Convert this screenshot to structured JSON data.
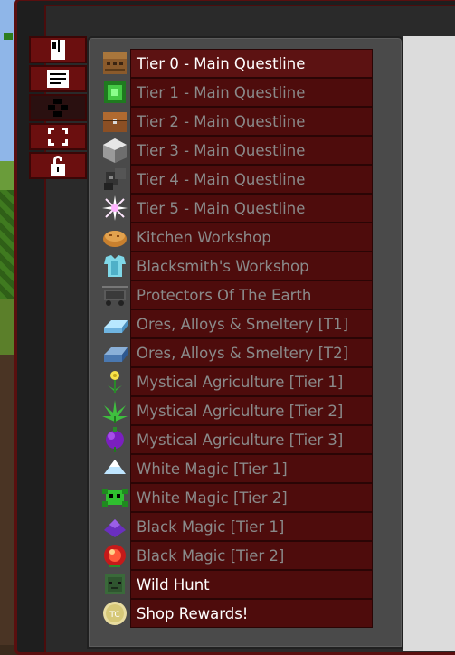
{
  "side_tabs": [
    {
      "icon": "book-icon",
      "active": false
    },
    {
      "icon": "notes-icon",
      "active": false
    },
    {
      "icon": "party-icon",
      "active": true
    },
    {
      "icon": "expand-icon",
      "active": false
    },
    {
      "icon": "lock-icon",
      "active": false
    }
  ],
  "questlines": [
    {
      "label": "Tier 0 - Main Questline",
      "icon": "crafting-table-icon",
      "unlocked": true,
      "selected": true
    },
    {
      "label": "Tier 1 - Main Questline",
      "icon": "green-circuit-icon",
      "unlocked": false
    },
    {
      "label": "Tier 2 - Main Questline",
      "icon": "wooden-chest-icon",
      "unlocked": false
    },
    {
      "label": "Tier 3 - Main Questline",
      "icon": "iron-block-icon",
      "unlocked": false
    },
    {
      "label": "Tier 4 - Main Questline",
      "icon": "dark-machine-icon",
      "unlocked": false
    },
    {
      "label": "Tier 5 - Main Questline",
      "icon": "nether-star-icon",
      "unlocked": false
    },
    {
      "label": "Kitchen Workshop",
      "icon": "pie-icon",
      "unlocked": false
    },
    {
      "label": "Blacksmith's Workshop",
      "icon": "diamond-chestplate-icon",
      "unlocked": false
    },
    {
      "label": "Protectors Of The Earth",
      "icon": "minecart-rail-icon",
      "unlocked": false
    },
    {
      "label": "Ores, Alloys & Smeltery [T1]",
      "icon": "ice-ingot-icon",
      "unlocked": false
    },
    {
      "label": "Ores, Alloys & Smeltery [T2]",
      "icon": "steel-ingot-icon",
      "unlocked": false
    },
    {
      "label": "Mystical Agriculture [Tier 1]",
      "icon": "yellow-flower-icon",
      "unlocked": false
    },
    {
      "label": "Mystical Agriculture [Tier 2]",
      "icon": "green-crop-icon",
      "unlocked": false
    },
    {
      "label": "Mystical Agriculture [Tier 3]",
      "icon": "purple-crop-icon",
      "unlocked": false
    },
    {
      "label": "White Magic [Tier 1]",
      "icon": "white-dust-icon",
      "unlocked": false
    },
    {
      "label": "White Magic [Tier 2]",
      "icon": "green-creature-icon",
      "unlocked": false
    },
    {
      "label": "Black Magic [Tier 1]",
      "icon": "purple-dust-icon",
      "unlocked": false
    },
    {
      "label": "Black Magic [Tier 2]",
      "icon": "red-orb-icon",
      "unlocked": false
    },
    {
      "label": "Wild Hunt",
      "icon": "zombie-head-icon",
      "unlocked": true
    },
    {
      "label": "Shop Rewards!",
      "icon": "coin-icon",
      "unlocked": true
    }
  ]
}
